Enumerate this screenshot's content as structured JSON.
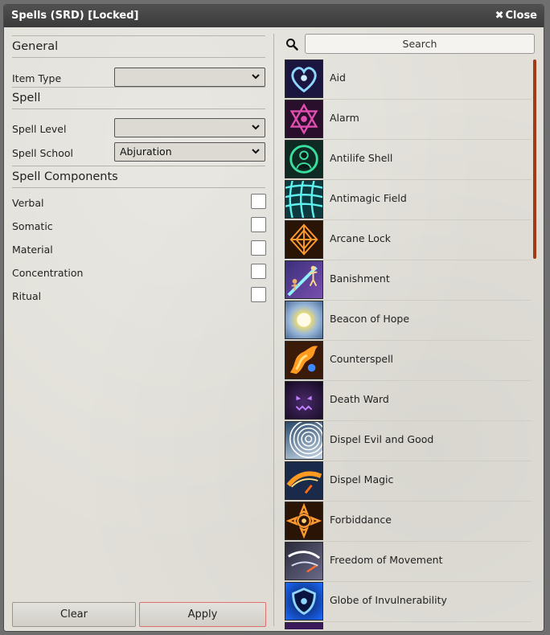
{
  "window": {
    "title": "Spells (SRD) [Locked]",
    "close_label": "Close",
    "close_icon": "close-x-icon"
  },
  "filters": {
    "general_header": "General",
    "item_type_label": "Item Type",
    "item_type_value": "",
    "spell_header": "Spell",
    "spell_level_label": "Spell Level",
    "spell_level_value": "",
    "spell_school_label": "Spell School",
    "spell_school_value": "Abjuration",
    "components_header": "Spell Components",
    "components": [
      {
        "label": "Verbal",
        "checked": false
      },
      {
        "label": "Somatic",
        "checked": false
      },
      {
        "label": "Material",
        "checked": false
      },
      {
        "label": "Concentration",
        "checked": false
      },
      {
        "label": "Ritual",
        "checked": false
      }
    ]
  },
  "buttons": {
    "clear": "Clear",
    "apply": "Apply",
    "apply_border_color": "#e07070"
  },
  "search": {
    "placeholder": "Search",
    "icon": "search-icon"
  },
  "spells": [
    {
      "name": "Aid",
      "icon": "heart-icon"
    },
    {
      "name": "Alarm",
      "icon": "hexagram-icon"
    },
    {
      "name": "Antilife Shell",
      "icon": "shield-figure-icon"
    },
    {
      "name": "Antimagic Field",
      "icon": "grid-field-icon"
    },
    {
      "name": "Arcane Lock",
      "icon": "rune-lock-icon"
    },
    {
      "name": "Banishment",
      "icon": "figure-beam-icon"
    },
    {
      "name": "Beacon of Hope",
      "icon": "radiant-sun-icon"
    },
    {
      "name": "Counterspell",
      "icon": "flame-hands-icon"
    },
    {
      "name": "Death Ward",
      "icon": "skull-face-icon"
    },
    {
      "name": "Dispel Evil and Good",
      "icon": "spiral-icon"
    },
    {
      "name": "Dispel Magic",
      "icon": "fire-bow-icon"
    },
    {
      "name": "Forbiddance",
      "icon": "rune-circle-icon"
    },
    {
      "name": "Freedom of Movement",
      "icon": "chain-break-icon"
    },
    {
      "name": "Globe of Invulnerability",
      "icon": "blue-shield-icon"
    }
  ],
  "colors": {
    "accent": "#a23a1a",
    "titlebar": "#444444"
  }
}
